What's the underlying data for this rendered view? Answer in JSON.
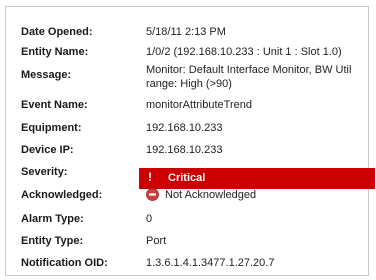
{
  "fields": {
    "date_opened": {
      "label": "Date Opened:",
      "value": "5/18/11 2:13 PM"
    },
    "entity_name": {
      "label": "Entity Name:",
      "value": "1/0/2 (192.168.10.233 : Unit 1 : Slot 1.0)"
    },
    "message": {
      "label": "Message:",
      "value_line1": "Monitor: Default Interface Monitor, BW Util",
      "value_line2": "range: High (>90)"
    },
    "event_name": {
      "label": "Event Name:",
      "value": "monitorAttributeTrend"
    },
    "equipment": {
      "label": "Equipment:",
      "value": "192.168.10.233"
    },
    "device_ip": {
      "label": "Device IP:",
      "value": "192.168.10.233"
    },
    "severity": {
      "label": "Severity:",
      "value": "Critical",
      "icon": "exclamation-icon",
      "color": "#cc0000"
    },
    "acknowledged": {
      "label": "Acknowledged:",
      "value": "Not Acknowledged",
      "icon": "no-entry-icon",
      "icon_color": "#d23c3c"
    },
    "alarm_type": {
      "label": "Alarm Type:",
      "value": "0"
    },
    "entity_type": {
      "label": "Entity Type:",
      "value": "Port"
    },
    "notification_oid": {
      "label": "Notification OID:",
      "value": "1.3.6.1.4.1.3477.1.27.20.7"
    }
  }
}
